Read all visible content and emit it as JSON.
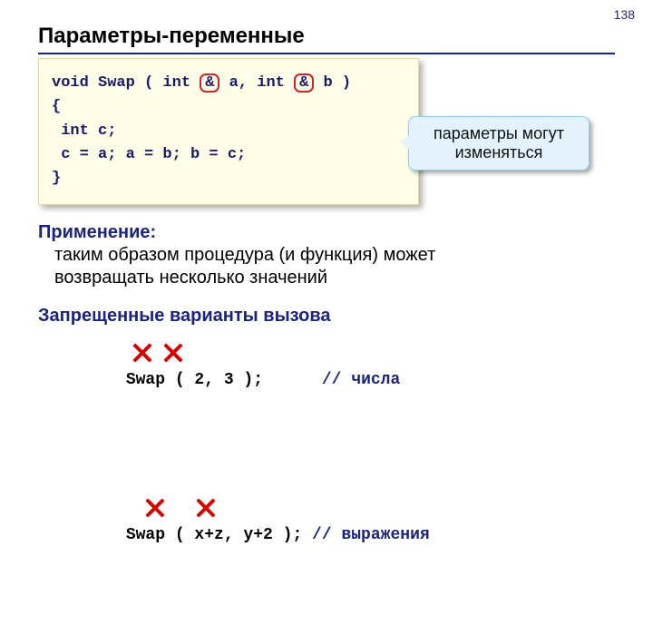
{
  "page_number": "138",
  "title": "Параметры-переменные",
  "code": {
    "t1a": "void Swap ( int ",
    "amp1": "&",
    "t1b": " a, int ",
    "amp2": "&",
    "t1c": " b )",
    "l2": "{",
    "l3": " int c;",
    "l4": " c = a; a = b; b = c;",
    "l5": "}"
  },
  "callout": {
    "line1": "параметры могут",
    "line2": "изменяться"
  },
  "application": {
    "lead": "Применение:",
    "body_l1": "таким образом процедура (и функция) может",
    "body_l2": "возвращать несколько значений"
  },
  "forbidden_heading": "Запрещенные варианты вызова",
  "bad1": {
    "code": "Swap ( 2, 3 );      ",
    "comment": "// числа"
  },
  "bad2": {
    "code": "Swap ( x+z, y+2 ); ",
    "comment": "// выражения"
  }
}
